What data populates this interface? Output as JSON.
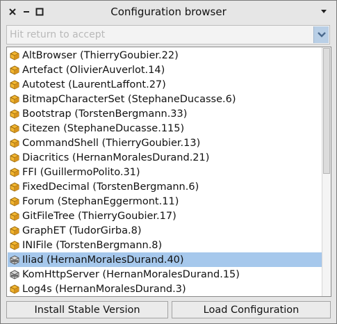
{
  "window": {
    "title": "Configuration browser"
  },
  "search": {
    "placeholder": "Hit return to accept",
    "value": ""
  },
  "configs": [
    {
      "name": "AltBrowser",
      "owner": "ThierryGoubier.22",
      "loaded": false,
      "selected": false
    },
    {
      "name": "Artefact",
      "owner": "OlivierAuverlot.14",
      "loaded": false,
      "selected": false
    },
    {
      "name": "Autotest",
      "owner": "LaurentLaffont.27",
      "loaded": false,
      "selected": false
    },
    {
      "name": "BitmapCharacterSet",
      "owner": "StephaneDucasse.6",
      "loaded": false,
      "selected": false
    },
    {
      "name": "Bootstrap",
      "owner": "TorstenBergmann.33",
      "loaded": false,
      "selected": false
    },
    {
      "name": "Citezen",
      "owner": "StephaneDucasse.115",
      "loaded": false,
      "selected": false
    },
    {
      "name": "CommandShell",
      "owner": "ThierryGoubier.13",
      "loaded": false,
      "selected": false
    },
    {
      "name": "Diacritics",
      "owner": "HernanMoralesDurand.21",
      "loaded": false,
      "selected": false
    },
    {
      "name": "FFI",
      "owner": "GuillermoPolito.31",
      "loaded": false,
      "selected": false
    },
    {
      "name": "FixedDecimal",
      "owner": "TorstenBergmann.6",
      "loaded": false,
      "selected": false
    },
    {
      "name": "Forum",
      "owner": "StephanEggermont.11",
      "loaded": false,
      "selected": false
    },
    {
      "name": "GitFileTree",
      "owner": "ThierryGoubier.17",
      "loaded": false,
      "selected": false
    },
    {
      "name": "GraphET",
      "owner": "TudorGirba.8",
      "loaded": false,
      "selected": false
    },
    {
      "name": "INIFile",
      "owner": "TorstenBergmann.8",
      "loaded": false,
      "selected": false
    },
    {
      "name": "Iliad",
      "owner": "HernanMoralesDurand.40",
      "loaded": true,
      "selected": true
    },
    {
      "name": "KomHttpServer",
      "owner": "HernanMoralesDurand.15",
      "loaded": true,
      "selected": false
    },
    {
      "name": "Log4s",
      "owner": "HernanMoralesDurand.3",
      "loaded": false,
      "selected": false
    }
  ],
  "buttons": {
    "install": "Install Stable Version",
    "load": "Load Configuration"
  },
  "colors": {
    "selection": "#a6c8ec",
    "package_icon": "#f2b630",
    "loaded_icon": "#7a7a7a"
  },
  "icons": {
    "package": "package-icon",
    "loaded": "loaded-package-icon"
  }
}
